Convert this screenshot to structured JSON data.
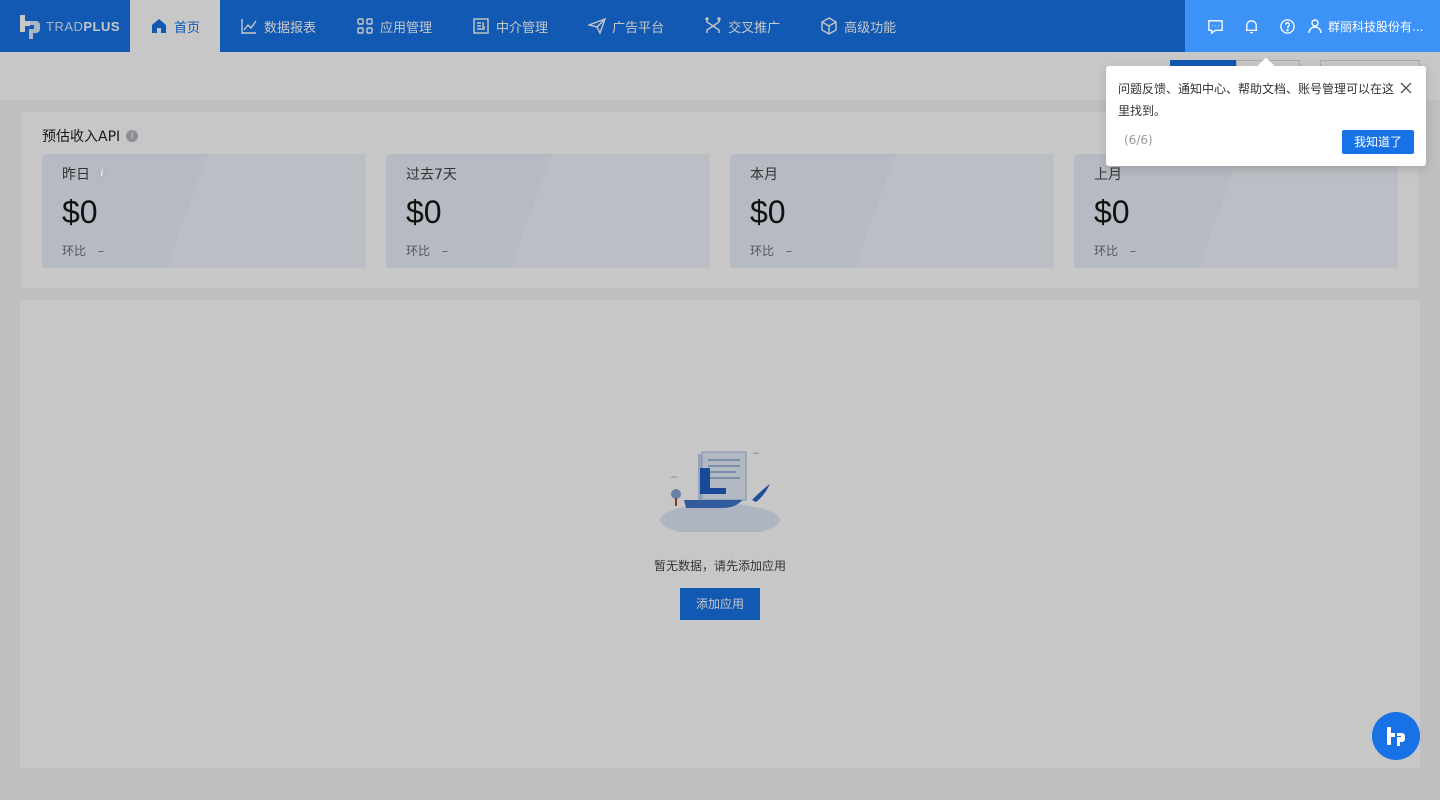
{
  "brand": {
    "logo_text_light": "TRAD",
    "logo_text_bold": "PLUS"
  },
  "nav": {
    "items": [
      {
        "label": "首页",
        "icon": "home-icon",
        "active": true
      },
      {
        "label": "数据报表",
        "icon": "line-chart-icon"
      },
      {
        "label": "应用管理",
        "icon": "grid-icon"
      },
      {
        "label": "中介管理",
        "icon": "document-icon"
      },
      {
        "label": "广告平台",
        "icon": "paper-plane-icon"
      },
      {
        "label": "交叉推广",
        "icon": "cross-arrows-icon"
      },
      {
        "label": "高级功能",
        "icon": "cube-icon"
      }
    ]
  },
  "top_right": {
    "icons": [
      "feedback-icon",
      "bell-icon",
      "help-icon"
    ],
    "user_name": "群丽科技股份有..."
  },
  "revenue": {
    "title": "预估收入API",
    "stats": [
      {
        "label": "昨日",
        "value": "$0",
        "compare_label": "环比",
        "compare_value": "–",
        "info": true
      },
      {
        "label": "过去7天",
        "value": "$0",
        "compare_label": "环比",
        "compare_value": "–"
      },
      {
        "label": "本月",
        "value": "$0",
        "compare_label": "环比",
        "compare_value": "–"
      },
      {
        "label": "上月",
        "value": "$0",
        "compare_label": "环比",
        "compare_value": "–"
      }
    ]
  },
  "empty_state": {
    "message": "暂无数据，请先添加应用",
    "button": "添加应用"
  },
  "guide_popover": {
    "text": "问题反馈、通知中心、帮助文档、账号管理可以在这里找到。",
    "step": "(6/6)",
    "button": "我知道了"
  },
  "colors": {
    "primary": "#1672e6",
    "highlight": "#3c92f7"
  }
}
